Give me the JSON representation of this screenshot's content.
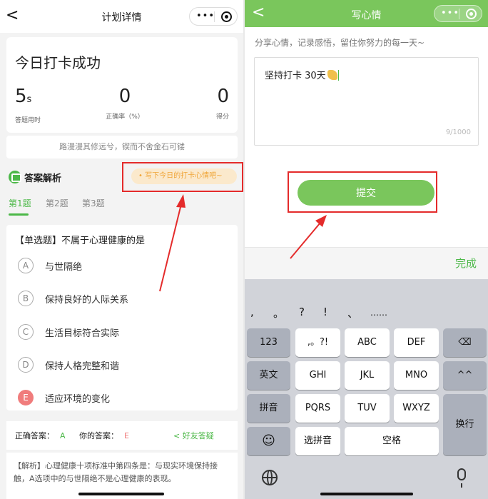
{
  "left": {
    "nav": {
      "back": "<",
      "title": "计划详情",
      "menu": "•••"
    },
    "success": {
      "title": "今日打卡成功",
      "stats": [
        {
          "value": "5",
          "unit": "s",
          "label": "答题用时"
        },
        {
          "value": "0",
          "unit": "",
          "label": "正确率（%）"
        },
        {
          "value": "0",
          "unit": "",
          "label": "得分"
        }
      ]
    },
    "motto": "路漫漫其修远兮，锲而不舍金石可镂",
    "analysis": {
      "title": "答案解析",
      "mood_prompt": "• 写下今日的打卡心情吧~"
    },
    "tabs": [
      "第1题",
      "第2题",
      "第3题"
    ],
    "question": {
      "text": "【单选题】不属于心理健康的是",
      "options": [
        {
          "letter": "A",
          "text": "与世隔绝"
        },
        {
          "letter": "B",
          "text": "保持良好的人际关系"
        },
        {
          "letter": "C",
          "text": "生活目标符合实际"
        },
        {
          "letter": "D",
          "text": "保持人格完整和谐"
        },
        {
          "letter": "E",
          "text": "适应环境的变化"
        }
      ]
    },
    "answers": {
      "correct_label": "正确答案：",
      "correct": "A",
      "yours_label": "你的答案：",
      "yours": "E",
      "ask_friend": "< 好友答疑"
    },
    "explanation": "【解析】心理健康十项标准中第四条是：与现实环境保持接触，A选项中的与世隔绝不是心理健康的表现。"
  },
  "right": {
    "nav": {
      "back": "<",
      "title": "写心情",
      "menu": "•••"
    },
    "hint": "分享心情，记录感悟，留住你努力的每一天~",
    "input_value": "坚持打卡 30天",
    "count": "9/1000",
    "submit": "提交",
    "done": "完成",
    "candidates": [
      ",",
      "。",
      "?",
      "!",
      "、",
      "……"
    ],
    "keys": {
      "row1": [
        "123",
        ",。?!",
        "ABC",
        "DEF"
      ],
      "row2": [
        "英文",
        "GHI",
        "JKL",
        "MNO",
        "^^"
      ],
      "row3": [
        "拼音",
        "PQRS",
        "TUV",
        "WXYZ"
      ],
      "row4": [
        "☺",
        "选拼音",
        "空格"
      ],
      "backspace": "⌫",
      "enter": "换行"
    }
  },
  "colors": {
    "accent": "#4cb848",
    "nav_green": "#7ac65c",
    "highlight": "#e42b2b",
    "wrong": "#f07c7c"
  }
}
